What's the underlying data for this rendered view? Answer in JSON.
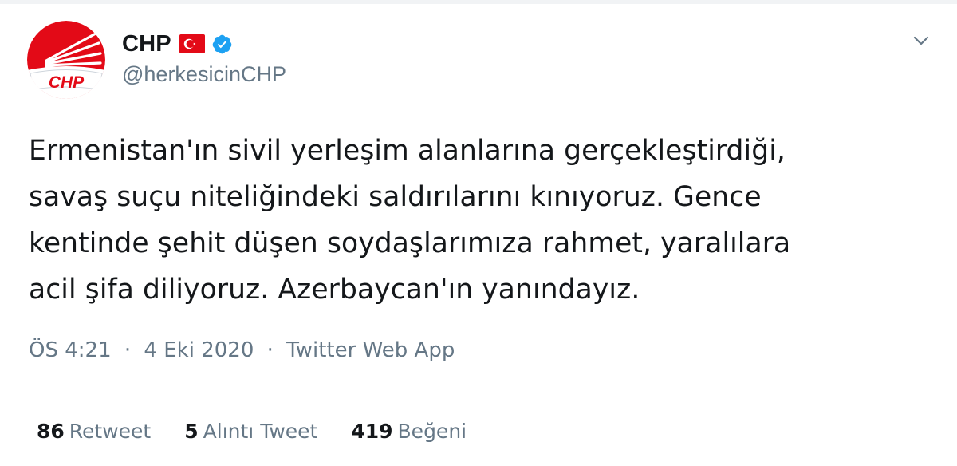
{
  "user": {
    "display_name": "CHP",
    "handle": "@herkesicinCHP",
    "avatar_text": "CHP",
    "flag_icon": "turkey-flag-icon",
    "verified_icon": "verified-badge-icon"
  },
  "tweet": {
    "text_lines": [
      "Ermenistan'ın sivil yerleşim alanlarına gerçekleştirdiği,",
      "savaş suçu niteliğindeki saldırılarını kınıyoruz. Gence",
      "kentinde şehit düşen soydaşlarımıza rahmet, yaralılara",
      "acil şifa diliyoruz. Azerbaycan'ın yanındayız."
    ],
    "time": "ÖS 4:21",
    "separator": "·",
    "date": "4 Eki 2020",
    "source": "Twitter Web App"
  },
  "stats": {
    "retweets": {
      "count": "86",
      "label": "Retweet"
    },
    "quotes": {
      "count": "5",
      "label": "Alıntı Tweet"
    },
    "likes": {
      "count": "419",
      "label": "Beğeni"
    }
  },
  "menu": {
    "icon": "chevron-down-icon"
  },
  "colors": {
    "text": "#14171a",
    "secondary": "#657786",
    "verified": "#1da1f2",
    "chp_red": "#e30a17",
    "divider": "#e1e8ed"
  }
}
